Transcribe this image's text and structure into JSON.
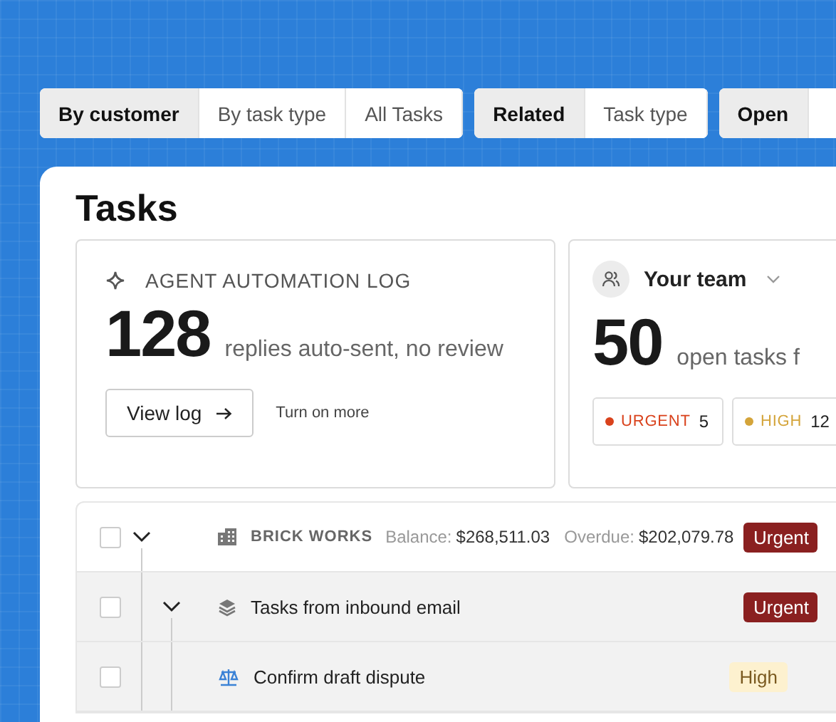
{
  "filter_groups": [
    {
      "options": [
        {
          "label": "By customer",
          "selected": true
        },
        {
          "label": "By task type",
          "selected": false
        },
        {
          "label": "All Tasks",
          "selected": false
        }
      ]
    },
    {
      "options": [
        {
          "label": "Related",
          "selected": true
        },
        {
          "label": "Task type",
          "selected": false
        }
      ]
    },
    {
      "options": [
        {
          "label": "Open",
          "selected": true
        }
      ]
    }
  ],
  "page_title": "Tasks",
  "automation_card": {
    "title": "AGENT AUTOMATION LOG",
    "count": "128",
    "description": "replies auto-sent, no review",
    "primary_button": "View log",
    "secondary_link": "Turn on more"
  },
  "team_card": {
    "selector": "Your team",
    "count": "50",
    "description": "open tasks f",
    "chips": [
      {
        "label": "URGENT",
        "count": "5",
        "color": "#d9421c"
      },
      {
        "label": "HIGH",
        "count": "12",
        "color": "#d4a43a"
      }
    ]
  },
  "table": {
    "rows": [
      {
        "kind": "customer",
        "checked": false,
        "expanded": true,
        "name": "BRICK WORKS",
        "balance_label": "Balance:",
        "balance": "$268,511.03",
        "overdue_label": "Overdue:",
        "overdue": "$202,079.78",
        "priority": {
          "label": "Urgent",
          "kind": "urgent"
        },
        "children": [
          {
            "kind": "group",
            "checked": false,
            "expanded": true,
            "name": "Tasks from inbound email",
            "priority": {
              "label": "Urgent",
              "kind": "urgent"
            },
            "children": [
              {
                "kind": "task",
                "checked": false,
                "name": "Confirm draft dispute",
                "priority": {
                  "label": "High",
                  "kind": "high"
                }
              }
            ]
          }
        ]
      }
    ]
  }
}
